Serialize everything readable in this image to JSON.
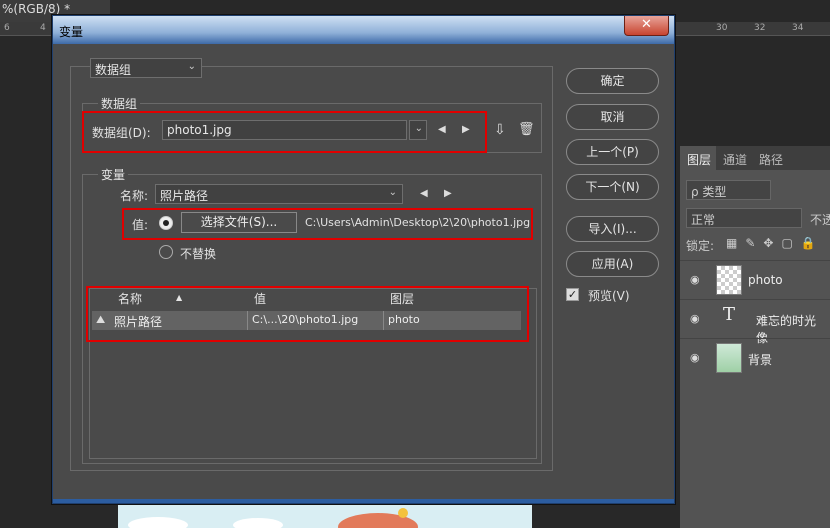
{
  "background": {
    "doc_tab": "%(RGB/8) *",
    "ruler_left": [
      "6",
      "4"
    ],
    "ruler_right": [
      "30",
      "32",
      "34"
    ],
    "layers_panel": {
      "tabs": [
        "图层",
        "通道",
        "路径"
      ],
      "filter": "ρ 类型",
      "blend": "正常",
      "opacity_label": "不透",
      "lock_label": "锁定:",
      "layers": [
        {
          "name": "photo"
        },
        {
          "name": "难忘的时光 像"
        },
        {
          "name": "背景"
        }
      ]
    }
  },
  "dialog": {
    "title": "变量",
    "close": "✕",
    "top_dropdown": "数据组",
    "dataset": {
      "legend": "数据组",
      "label": "数据组(D):",
      "value": "photo1.jpg"
    },
    "variables": {
      "legend": "变量",
      "name_label": "名称:",
      "name_value": "照片路径",
      "value_label": "值:",
      "choose_file": "选择文件(S)...",
      "file_path": "C:\\Users\\Admin\\Desktop\\2\\20\\photo1.jpg",
      "no_replace": "不替换"
    },
    "table": {
      "headers": [
        "名称",
        "值",
        "图层"
      ],
      "rows": [
        {
          "name": "照片路径",
          "value": "C:\\...\\20\\photo1.jpg",
          "layer": "photo"
        }
      ]
    },
    "buttons": {
      "ok": "确定",
      "cancel": "取消",
      "prev": "上一个(P)",
      "next": "下一个(N)",
      "import": "导入(I)...",
      "apply": "应用(A)"
    },
    "preview": "预览(V)"
  },
  "colors": {
    "highlight": "#e10000",
    "titlebar": "#3d6aa8"
  }
}
